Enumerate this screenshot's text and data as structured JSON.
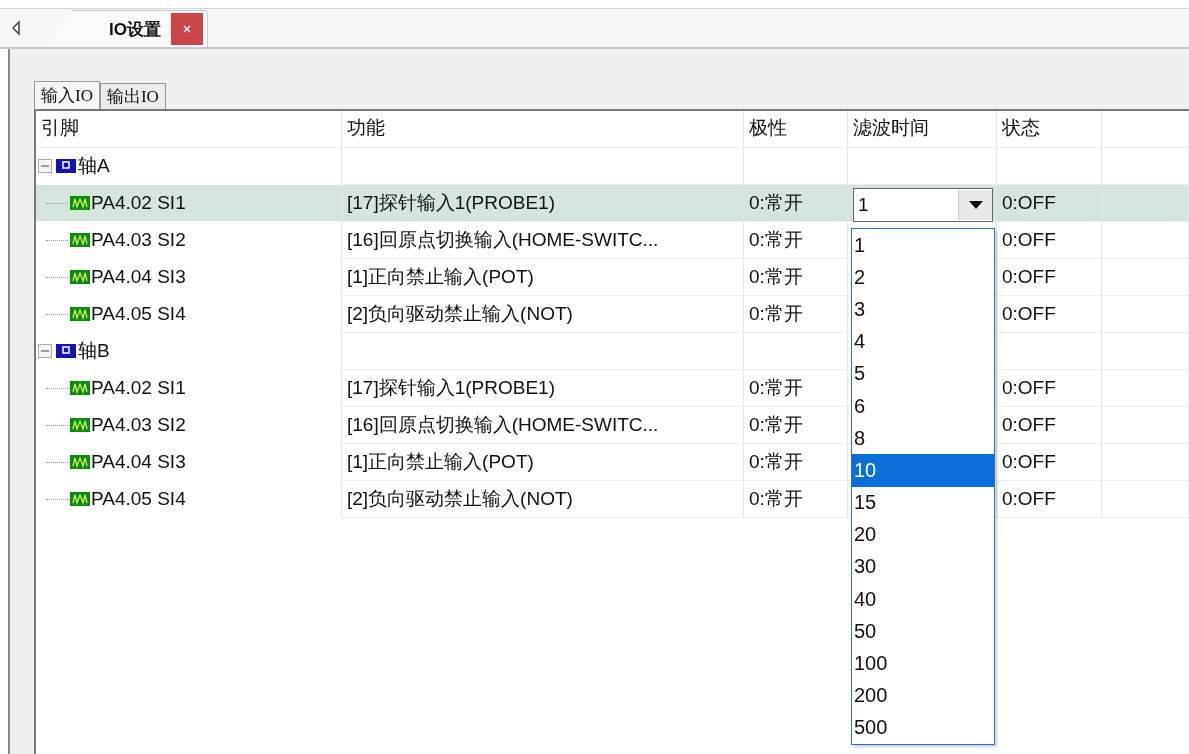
{
  "tabs": [
    {
      "label": "IO设置",
      "selected": true
    }
  ],
  "io_tabs": [
    {
      "label": "输入IO",
      "selected": true
    },
    {
      "label": "输出IO",
      "selected": false
    }
  ],
  "table": {
    "columns": [
      "引脚",
      "功能",
      "极性",
      "滤波时间",
      "状态"
    ],
    "groups": [
      {
        "name": "轴A",
        "expanded": true,
        "children": [
          {
            "pin": "PA4.02 SI1",
            "function": "[17]探针输入1(PROBE1)",
            "polarity": "0:常开",
            "filter": "1",
            "status": "0:OFF",
            "selected": true
          },
          {
            "pin": "PA4.03 SI2",
            "function": "[16]回原点切换输入(HOME-SWITC...",
            "polarity": "0:常开",
            "status": "0:OFF",
            "selected": false
          },
          {
            "pin": "PA4.04 SI3",
            "function": "[1]正向禁止输入(POT)",
            "polarity": "0:常开",
            "status": "0:OFF",
            "selected": false
          },
          {
            "pin": "PA4.05 SI4",
            "function": "[2]负向驱动禁止输入(NOT)",
            "polarity": "0:常开",
            "status": "0:OFF",
            "selected": false
          }
        ]
      },
      {
        "name": "轴B",
        "expanded": true,
        "children": [
          {
            "pin": "PA4.02 SI1",
            "function": "[17]探针输入1(PROBE1)",
            "polarity": "0:常开",
            "status": "0:OFF",
            "selected": false
          },
          {
            "pin": "PA4.03 SI2",
            "function": "[16]回原点切换输入(HOME-SWITC...",
            "polarity": "0:常开",
            "status": "0:OFF",
            "selected": false
          },
          {
            "pin": "PA4.04 SI3",
            "function": "[1]正向禁止输入(POT)",
            "polarity": "0:常开",
            "status": "0:OFF",
            "selected": false
          },
          {
            "pin": "PA4.05 SI4",
            "function": "[2]负向驱动禁止输入(NOT)",
            "polarity": "0:常开",
            "status": "0:OFF",
            "selected": false
          }
        ]
      }
    ]
  },
  "dropdown": {
    "options": [
      {
        "label": "1",
        "selected": false
      },
      {
        "label": "2",
        "selected": false
      },
      {
        "label": "3",
        "selected": false
      },
      {
        "label": "4",
        "selected": false
      },
      {
        "label": "5",
        "selected": false
      },
      {
        "label": "6",
        "selected": false
      },
      {
        "label": "8",
        "selected": false
      },
      {
        "label": "10",
        "selected": true
      },
      {
        "label": "15",
        "selected": false
      },
      {
        "label": "20",
        "selected": false
      },
      {
        "label": "30",
        "selected": false
      },
      {
        "label": "40",
        "selected": false
      },
      {
        "label": "50",
        "selected": false
      },
      {
        "label": "100",
        "selected": false
      },
      {
        "label": "200",
        "selected": false
      },
      {
        "label": "500",
        "selected": false
      }
    ]
  }
}
